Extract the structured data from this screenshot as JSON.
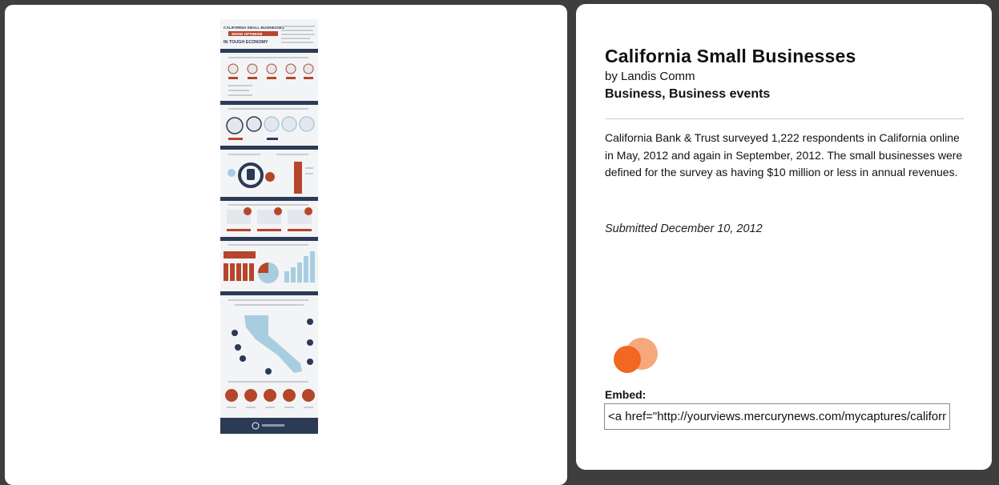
{
  "article": {
    "title": "California Small Businesses",
    "byline": "by Landis Comm",
    "categories": "Business, Business events",
    "description": "California Bank & Trust surveyed 1,222 respondents in California online in May, 2012 and again in September, 2012. The small businesses were defined for the survey as having $10 million or less in annual revenues.",
    "submitted": "Submitted December 10, 2012"
  },
  "embed": {
    "label": "Embed:",
    "value": "<a href=\"http://yourviews.mercurynews.com/mycaptures/california-small-businesses\">"
  },
  "infographic": {
    "heading_lines": [
      "CALIFORNIA SMALL BUSINESSES",
      "SHOW OPTIMISM",
      "IN TOUGH ECONOMY"
    ]
  },
  "colors": {
    "navy": "#2b3a55",
    "rust": "#b5462b",
    "light_blue": "#a8cde0",
    "logo_red": "#f26722",
    "logo_peach": "#f7a77c"
  }
}
